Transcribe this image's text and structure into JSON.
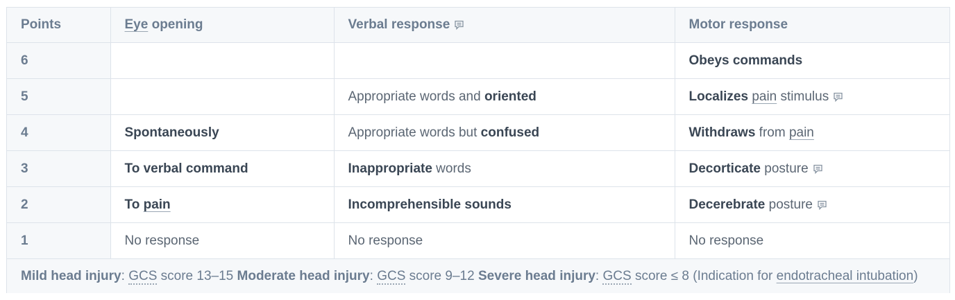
{
  "header": {
    "points": "Points",
    "eye_prefix": "Eye",
    "eye_suffix": " opening",
    "verbal": "Verbal response",
    "motor": "Motor response"
  },
  "rows": [
    {
      "points": "6",
      "eye": "",
      "verbal": {
        "a": "",
        "b": ""
      },
      "motor": {
        "a": "Obeys commands"
      }
    },
    {
      "points": "5",
      "eye": "",
      "verbal": {
        "a": "Appropriate words and ",
        "b": "oriented"
      },
      "motor": {
        "a": "Localizes",
        "b": " ",
        "link": "pain",
        "c": " stimulus"
      }
    },
    {
      "points": "4",
      "eye": "Spontaneously",
      "verbal": {
        "a": "Appropriate words but ",
        "b": "confused"
      },
      "motor": {
        "a": "Withdraws",
        "b": " from ",
        "link": "pain"
      }
    },
    {
      "points": "3",
      "eye": "To verbal command",
      "verbal": {
        "a": "Inappropriate",
        "b": " words"
      },
      "motor": {
        "a": "Decorticate",
        "b": " posture"
      }
    },
    {
      "points": "2",
      "eye_a": "To ",
      "eye_link": "pain",
      "verbal": {
        "a": "Incomprehensible sounds"
      },
      "motor": {
        "a": "Decerebrate",
        "b": " posture"
      }
    },
    {
      "points": "1",
      "eye": "No response",
      "verbal": {
        "a": "No response"
      },
      "motor": {
        "a": "No response"
      }
    }
  ],
  "footer": {
    "mild_label": "Mild head injury",
    "colon": ":",
    "gcs": "GCS",
    "mild_score": " score 13–15 ",
    "moderate_label": "Moderate head injury",
    "moderate_score": " score 9–12 ",
    "severe_label": "Severe head injury",
    "severe_score": " score ≤ 8 (Indication for ",
    "link": "endotracheal intubation",
    "close": ")"
  },
  "icons": {
    "note": "note-icon"
  },
  "colors": {
    "header_bg": "#f6f8fa",
    "border": "#dde3ea",
    "muted_text": "#6b7c90",
    "body_text": "#3a4654"
  }
}
